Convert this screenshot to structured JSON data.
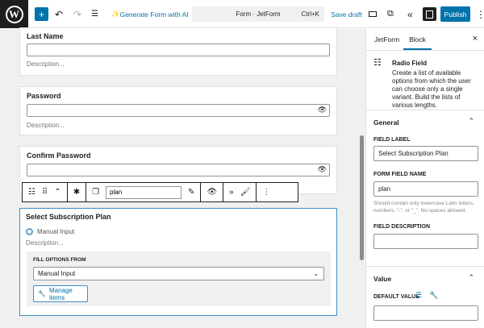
{
  "topbar": {
    "add": "+",
    "undo": "↶",
    "redo": "↷",
    "list": "☰",
    "generate": "Generate Form with AI",
    "command_title": "Form · JetForm",
    "shortcut": "Ctrl+K",
    "save_draft": "Save draft",
    "publish": "Publish",
    "more": "⋮"
  },
  "canvas": {
    "fields": [
      {
        "label": "Last Name",
        "description": "Description..."
      },
      {
        "label": "Password",
        "description": "Description..."
      },
      {
        "label": "Confirm Password"
      }
    ],
    "toolbar": {
      "name_value": "plan"
    },
    "selected": {
      "label": "Select Subscription Plan",
      "option": "Manual Input",
      "description": "Description...",
      "fill_label": "FILL OPTIONS FROM",
      "fill_value": "Manual Input",
      "manage": "Manage items"
    }
  },
  "sidebar": {
    "tabs": [
      "JetForm",
      "Block"
    ],
    "block_title": "Radio Field",
    "block_desc": "Create a list of available options from which the user can choose only a single variant. Build the lists of various lengths.",
    "general": "General",
    "field_label": "FIELD LABEL",
    "field_label_value": "Select Subscription Plan",
    "field_name": "FORM FIELD NAME",
    "field_name_value": "plan",
    "field_name_help": "Should contain only lowercase Latin letters, numbers, \"-\", or \"_\". No spaces allowed.",
    "field_desc": "FIELD DESCRIPTION",
    "value": "Value",
    "default_value": "DEFAULT VALUE"
  },
  "colors": {
    "accent": "#0073aa",
    "selected_border": "#3e8ec6"
  }
}
